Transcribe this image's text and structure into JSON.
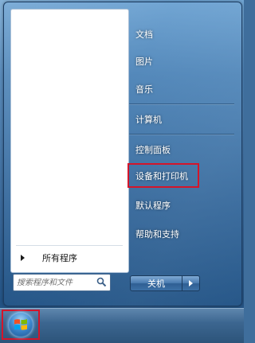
{
  "start_menu": {
    "all_programs": "所有程序",
    "search": {
      "placeholder": "搜索程序和文件"
    },
    "right_items": [
      {
        "label": "文档"
      },
      {
        "label": "图片"
      },
      {
        "label": "音乐"
      },
      {
        "label": "计算机"
      },
      {
        "label": "控制面板"
      },
      {
        "label": "设备和打印机"
      },
      {
        "label": "默认程序"
      },
      {
        "label": "帮助和支持"
      }
    ],
    "shutdown_label": "关机"
  },
  "colors": {
    "highlight": "#d4152a",
    "menu_panel": "#ffffff",
    "right_text": "#ffffff"
  },
  "icons": [
    "search-icon",
    "arrow-right-icon",
    "windows-logo-icon"
  ]
}
